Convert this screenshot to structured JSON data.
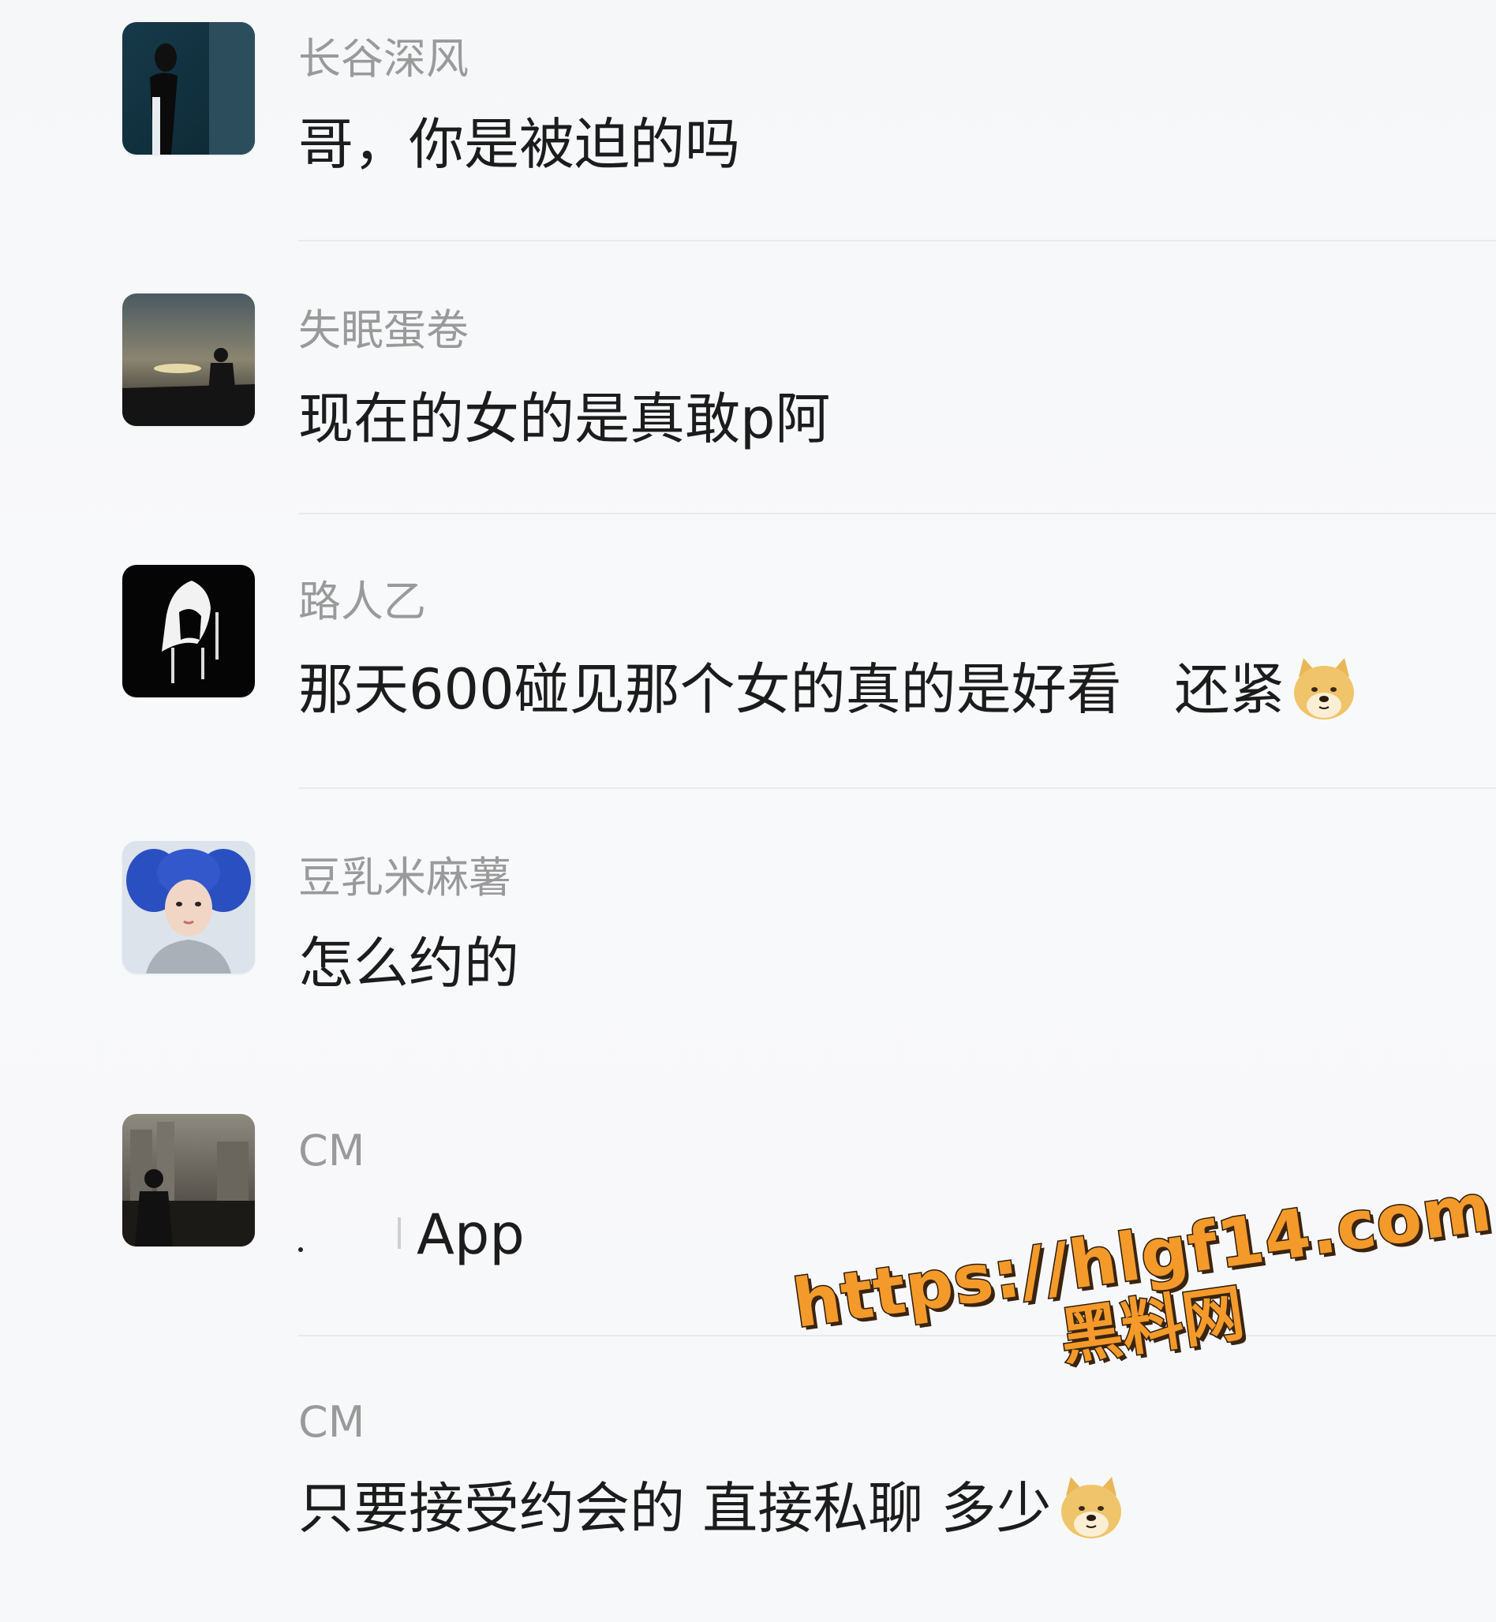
{
  "comments": [
    {
      "username": "长谷深风",
      "message": "哥，你是被迫的吗"
    },
    {
      "username": "失眠蛋卷",
      "message": "现在的女的是真敢p阿"
    },
    {
      "username": "路人乙",
      "message": "那天600碰见那个女的真的是好看   还紧"
    },
    {
      "username": "豆乳米麻薯",
      "message": "怎么约的"
    },
    {
      "username": "CM",
      "message": "App"
    },
    {
      "username": "CM",
      "message": "只要接受约会的 直接私聊 多少"
    }
  ],
  "emoji": {
    "name": "doge-emoji"
  },
  "watermark": {
    "url": "https://hlgf14.com",
    "site": "黑料网"
  },
  "colors": {
    "background": "#f7f8fa",
    "username": "#9a9a9a",
    "message": "#1c1c1c",
    "divider": "#e9eaed",
    "watermark": "#f39a2b"
  }
}
